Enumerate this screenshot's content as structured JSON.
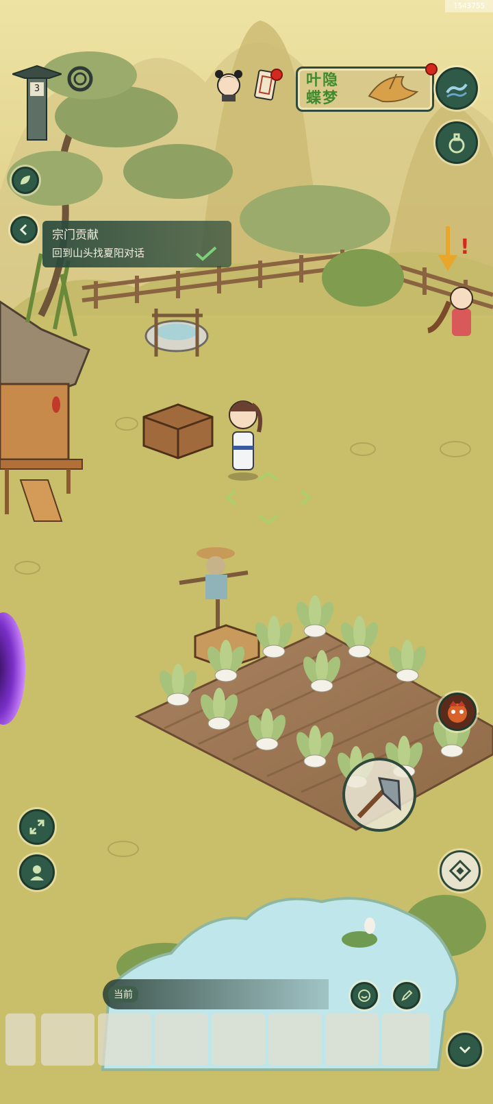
{
  "hud": {
    "top_right_id": "1543755",
    "level_number": "3",
    "event_banner_title": "叶隐蝶梦"
  },
  "quest": {
    "title": "宗门贡献",
    "description": "回到山头找夏阳对话"
  },
  "chat": {
    "channel_label": "当前"
  },
  "hotbar": {
    "slots": [
      "",
      "",
      "",
      "",
      "",
      "",
      ""
    ]
  },
  "colors": {
    "sky": "#e8d88e",
    "grass": "#c9bf6a",
    "button_fill": "#2f5a48",
    "soil": "#a07a54",
    "water": "#bfe6ea"
  },
  "icons": {
    "level_pillar": "stone-pillar-icon",
    "portal": "swirl-portal-icon",
    "left_leaf_button": "leaf-icon",
    "quest_back": "chevron-left-icon",
    "quest_done": "checkmark-icon",
    "top_right_1": "wave-icon",
    "top_right_2": "gourd-icon",
    "expand": "expand-arrows-icon",
    "profile": "character-portrait-icon",
    "tool": "axe-icon",
    "compass": "diamond-compass-icon",
    "chat_emoji": "smile-icon",
    "chat_send": "pen-icon",
    "collapse": "chevron-down-icon",
    "monster": "red-monster-face-icon"
  }
}
